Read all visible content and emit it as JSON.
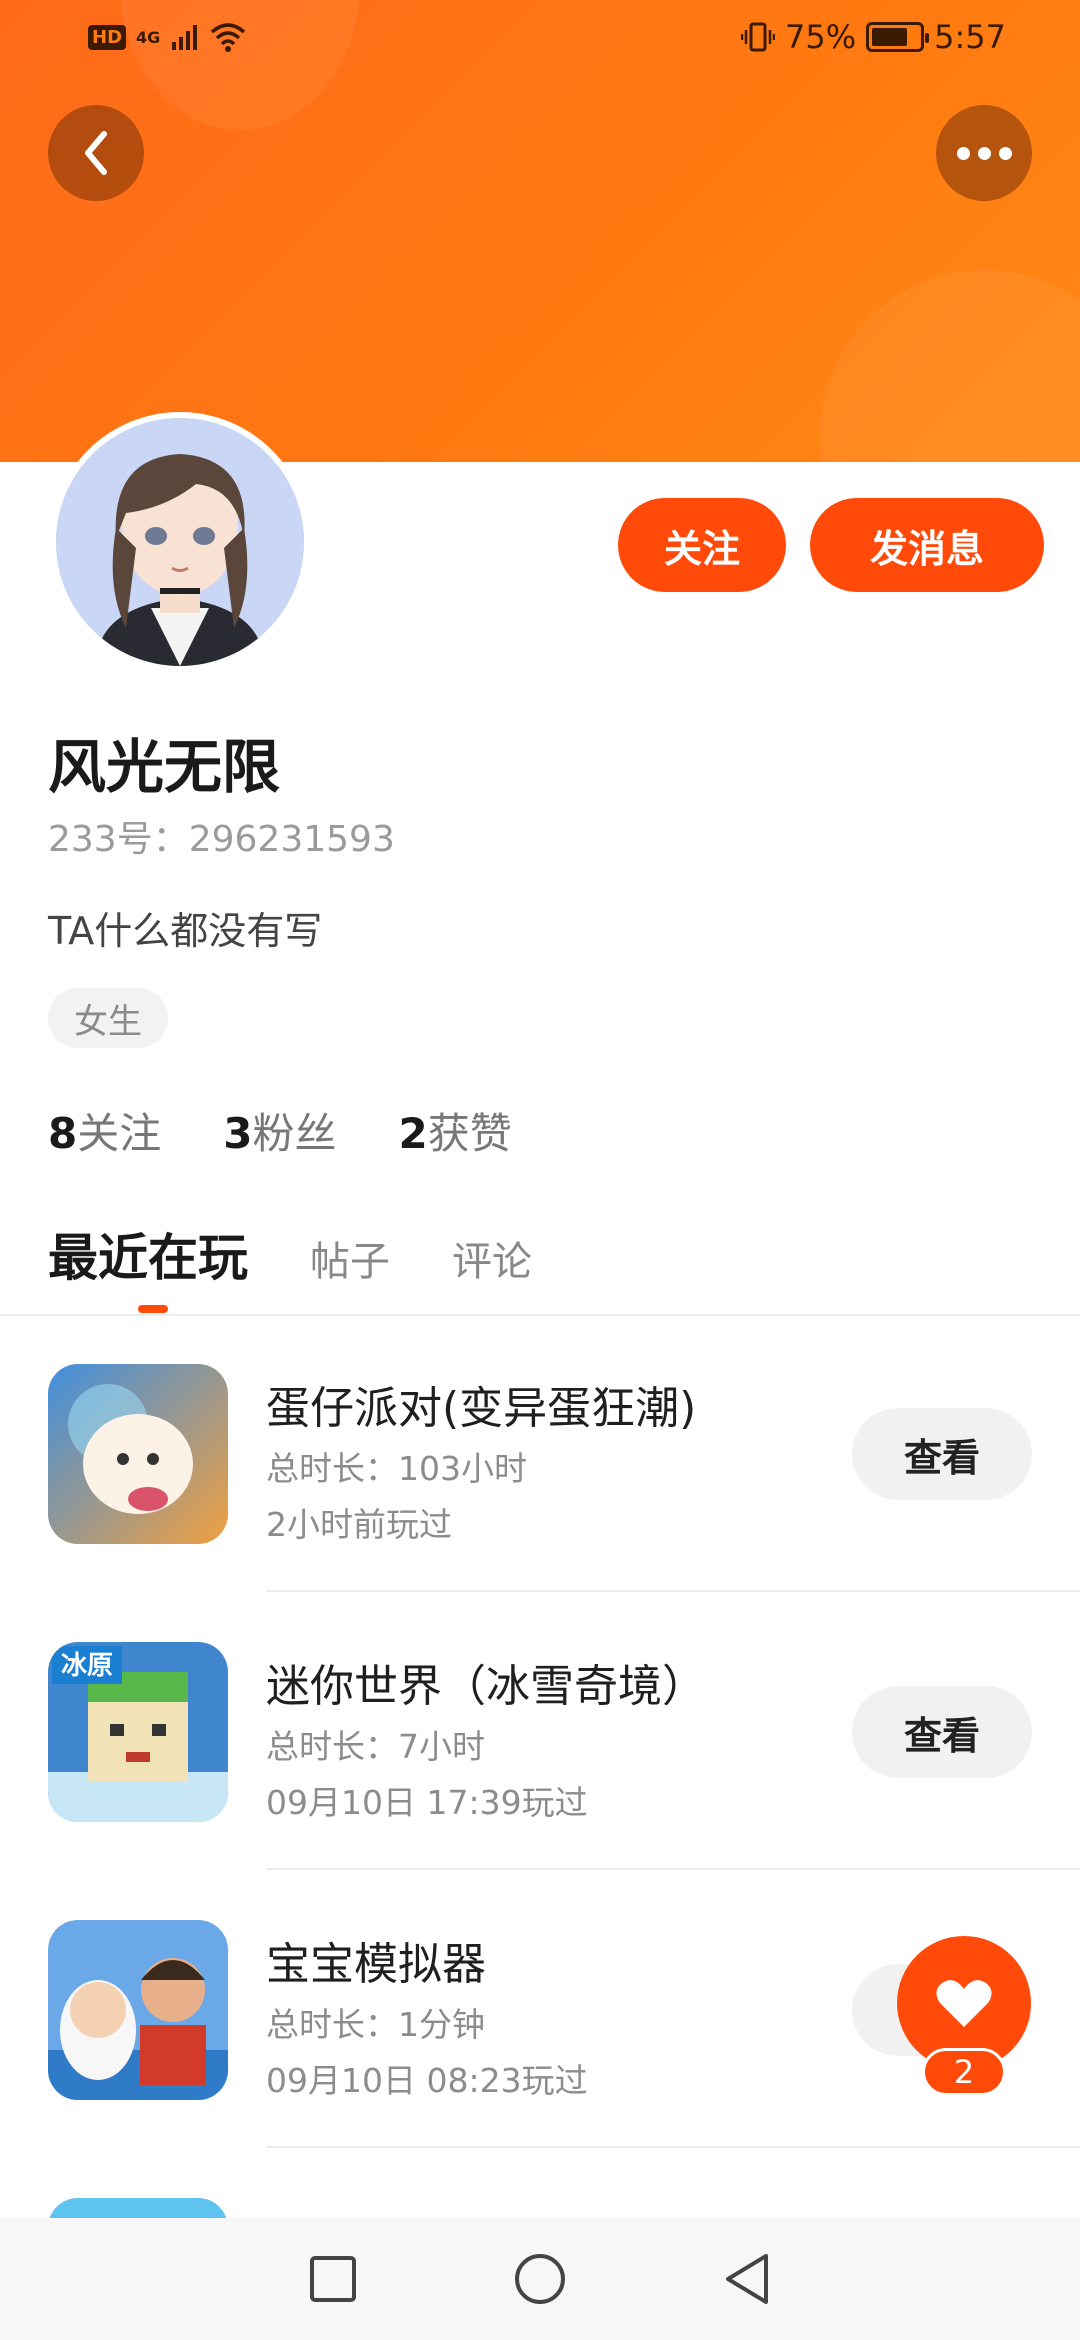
{
  "status_bar": {
    "hd": "HD",
    "network": "4G",
    "battery_text": "75%",
    "battery_level": 0.75,
    "time": "5:57"
  },
  "header": {
    "back_icon": "chevron-left-icon",
    "more_icon": "more-dots-icon"
  },
  "profile": {
    "follow_label": "关注",
    "message_label": "发消息",
    "name": "风光无限",
    "uid": "233号：296231593",
    "bio": "TA什么都没有写",
    "gender_tag": "女生",
    "stats": [
      {
        "count": "8",
        "label": "关注"
      },
      {
        "count": "3",
        "label": "粉丝"
      },
      {
        "count": "2",
        "label": "获赞"
      }
    ]
  },
  "tabs": [
    {
      "label": "最近在玩",
      "active": true
    },
    {
      "label": "帖子",
      "active": false
    },
    {
      "label": "评论",
      "active": false
    }
  ],
  "games": [
    {
      "title": "蛋仔派对(变异蛋狂潮)",
      "duration": "总时长：103小时",
      "last_played": "2小时前玩过",
      "button": "查看"
    },
    {
      "title": "迷你世界（冰雪奇境）",
      "duration": "总时长：7小时",
      "last_played": "09月10日 17:39玩过",
      "button": "查看",
      "icon_text": "冰原"
    },
    {
      "title": "宝宝模拟器",
      "duration": "总时长：1分钟",
      "last_played": "09月10日 08:23玩过",
      "button": "查看"
    }
  ],
  "like_fab": {
    "icon": "heart-icon",
    "count": "2"
  },
  "nav": {
    "square": "recent-apps-icon",
    "circle": "home-icon",
    "triangle": "back-triangle-icon"
  },
  "colors": {
    "accent": "#ff4a0a",
    "banner": "#ff7a10"
  }
}
